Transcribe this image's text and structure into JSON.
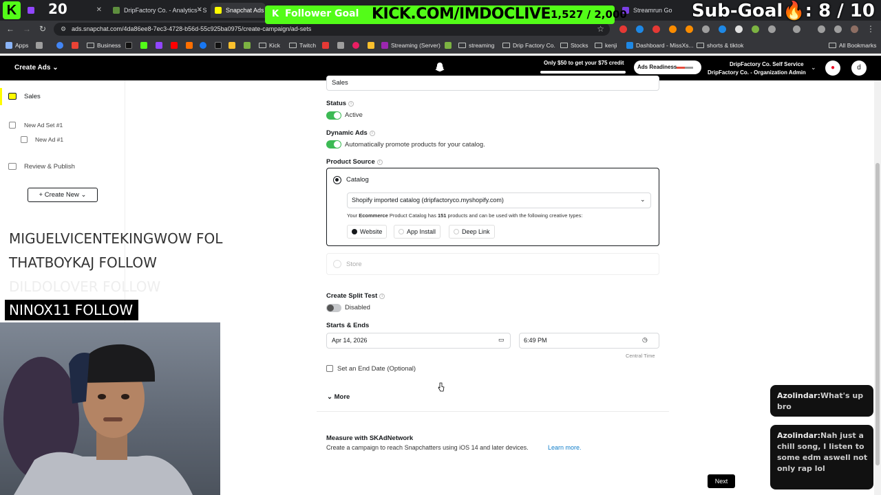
{
  "browser": {
    "tabs": [
      {
        "label": "20",
        "favicon_color": "#9146ff"
      },
      {
        "label": "DripFactory Co. - Analytics - Sh",
        "favicon_color": "#5e8e3e"
      },
      {
        "label": "Snapchat Ads M",
        "favicon_color": "#fffc00"
      },
      {
        "label": "Streamrun Go",
        "favicon_color": "#7b3fe4"
      }
    ],
    "url": "ads.snapchat.com/4da86ee8-7ec3-4728-b56d-55c925ba0975/create-campaign/ad-sets",
    "bookmarks": [
      "Apps",
      "Business",
      "Kick",
      "Twitch",
      "Streaming (Server)",
      "streaming",
      "Drip Factory Co.",
      "Stocks",
      "kenji",
      "Dashboard - MissXs...",
      "shorts & tiktok",
      "All Bookmarks"
    ]
  },
  "header": {
    "title": "Create Ads",
    "promo_text": "Only $50 to get your $75 credit",
    "readiness_label": "Ads Readiness",
    "org_line1": "DripFactory Co. Self Service",
    "org_line2": "DripFactory Co. - Organization Admin",
    "avatar_letter": "d"
  },
  "sidebar": {
    "campaign": "Sales",
    "ad_set": "New Ad Set #1",
    "ad": "New Ad #1",
    "review": "Review & Publish",
    "create_new": "Create New"
  },
  "form": {
    "objective_value": "Sales",
    "status_label": "Status",
    "status_value": "Active",
    "dynamic_label": "Dynamic Ads",
    "dynamic_value": "Automatically promote products for your catalog.",
    "product_source_label": "Product Source",
    "catalog_option": "Catalog",
    "catalog_select": "Shopify imported catalog (dripfactoryco.myshopify.com)",
    "catalog_note_pre": "Your",
    "catalog_note_type": "Ecommerce",
    "catalog_note_mid": "Product Catalog has",
    "catalog_note_count": "151",
    "catalog_note_post": "products and can be used with the following creative types:",
    "creative_types": [
      "Website",
      "App Install",
      "Deep Link"
    ],
    "store_option": "Store",
    "split_label": "Create Split Test",
    "split_value": "Disabled",
    "starts_label": "Starts & Ends",
    "start_date": "Apr 14, 2026",
    "start_time": "6:49 PM",
    "timezone": "Central Time",
    "end_date_label": "Set an End Date (Optional)",
    "more_label": "More",
    "skad_title": "Measure with SKAdNetwork",
    "skad_desc": "Create a campaign to reach Snapchatters using iOS 14 and later devices.",
    "learn_more": "Learn more.",
    "next_label": "Next"
  },
  "overlay": {
    "tab_counter": "20",
    "follower_goal_label": "Follower Goal",
    "kick_url": "KICK.COM/IMDOCLIVE",
    "follower_count": "1,527 / 2,000",
    "sub_goal": "Sub-Goal🔥: 8 / 10",
    "ticker": [
      "MIGUELVICENTEKINGWOW  FOL",
      "THATBOYKAJ  FOLLOW",
      "DILDOLOVER  FOLLOW"
    ],
    "highlight_follow": "NINOX11  FOLLOW",
    "chat": [
      {
        "user": "Azolindar:",
        "message": "What's up bro"
      },
      {
        "user": "Azolindar:",
        "message": "Nah just a chill song, I listen to some edm aswell not only rap lol"
      }
    ]
  },
  "colors": {
    "snap_yellow": "#fffc00",
    "toggle_on": "#3cba54",
    "kick_green": "#53fc18",
    "link": "#0f7dca"
  }
}
